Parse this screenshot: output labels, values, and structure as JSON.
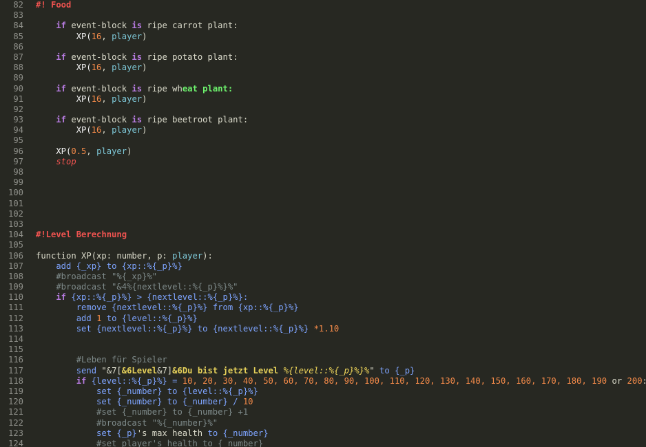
{
  "editor": {
    "lines": [
      {
        "n": "82",
        "tokens": [
          {
            "t": "#! Food",
            "c": "header"
          }
        ]
      },
      {
        "n": "83",
        "tokens": []
      },
      {
        "n": "84",
        "tokens": [
          {
            "t": "    if",
            "c": "kw"
          },
          {
            "t": " event-block ",
            "c": "plain"
          },
          {
            "t": "is",
            "c": "kw"
          },
          {
            "t": " ripe carrot plant:",
            "c": "plain"
          }
        ]
      },
      {
        "n": "85",
        "tokens": [
          {
            "t": "        XP(",
            "c": "fn"
          },
          {
            "t": "16",
            "c": "num"
          },
          {
            "t": ", ",
            "c": "plain"
          },
          {
            "t": "player",
            "c": "type"
          },
          {
            "t": ")",
            "c": "plain"
          }
        ]
      },
      {
        "n": "86",
        "tokens": []
      },
      {
        "n": "87",
        "tokens": [
          {
            "t": "    if",
            "c": "kw"
          },
          {
            "t": " event-block ",
            "c": "plain"
          },
          {
            "t": "is",
            "c": "kw"
          },
          {
            "t": " ripe potato plant:",
            "c": "plain"
          }
        ]
      },
      {
        "n": "88",
        "tokens": [
          {
            "t": "        XP(",
            "c": "fn"
          },
          {
            "t": "16",
            "c": "num"
          },
          {
            "t": ", ",
            "c": "plain"
          },
          {
            "t": "player",
            "c": "type"
          },
          {
            "t": ")",
            "c": "plain"
          }
        ]
      },
      {
        "n": "89",
        "tokens": []
      },
      {
        "n": "90",
        "tokens": [
          {
            "t": "    if",
            "c": "kw"
          },
          {
            "t": " event-block ",
            "c": "plain"
          },
          {
            "t": "is",
            "c": "kw"
          },
          {
            "t": " ripe wh",
            "c": "plain"
          },
          {
            "t": "eat plant:",
            "c": "hl"
          }
        ]
      },
      {
        "n": "91",
        "tokens": [
          {
            "t": "        XP(",
            "c": "fn"
          },
          {
            "t": "16",
            "c": "num"
          },
          {
            "t": ", ",
            "c": "plain"
          },
          {
            "t": "player",
            "c": "type"
          },
          {
            "t": ")",
            "c": "plain"
          }
        ]
      },
      {
        "n": "92",
        "tokens": []
      },
      {
        "n": "93",
        "tokens": [
          {
            "t": "    if",
            "c": "kw"
          },
          {
            "t": " event-block ",
            "c": "plain"
          },
          {
            "t": "is",
            "c": "kw"
          },
          {
            "t": " ripe beetroot plant:",
            "c": "plain"
          }
        ]
      },
      {
        "n": "94",
        "tokens": [
          {
            "t": "        XP(",
            "c": "fn"
          },
          {
            "t": "16",
            "c": "num"
          },
          {
            "t": ", ",
            "c": "plain"
          },
          {
            "t": "player",
            "c": "type"
          },
          {
            "t": ")",
            "c": "plain"
          }
        ]
      },
      {
        "n": "95",
        "tokens": []
      },
      {
        "n": "96",
        "tokens": [
          {
            "t": "    XP(",
            "c": "fn"
          },
          {
            "t": "0.5",
            "c": "num"
          },
          {
            "t": ", ",
            "c": "plain"
          },
          {
            "t": "player",
            "c": "type"
          },
          {
            "t": ")",
            "c": "plain"
          }
        ]
      },
      {
        "n": "97",
        "tokens": [
          {
            "t": "    stop",
            "c": "stop"
          }
        ]
      },
      {
        "n": "98",
        "tokens": []
      },
      {
        "n": "99",
        "tokens": []
      },
      {
        "n": "100",
        "tokens": []
      },
      {
        "n": "101",
        "tokens": []
      },
      {
        "n": "102",
        "tokens": []
      },
      {
        "n": "103",
        "tokens": []
      },
      {
        "n": "104",
        "tokens": [
          {
            "t": "#!Level Berechnung",
            "c": "header"
          }
        ]
      },
      {
        "n": "105",
        "tokens": []
      },
      {
        "n": "106",
        "tokens": [
          {
            "t": "function XP(xp: number, p: ",
            "c": "plain"
          },
          {
            "t": "player",
            "c": "type"
          },
          {
            "t": "):",
            "c": "plain"
          }
        ]
      },
      {
        "n": "107",
        "tokens": [
          {
            "t": "    add ",
            "c": "var"
          },
          {
            "t": "{_xp}",
            "c": "var"
          },
          {
            "t": " to ",
            "c": "var"
          },
          {
            "t": "{xp::%{_p}%}",
            "c": "var"
          }
        ]
      },
      {
        "n": "108",
        "tokens": [
          {
            "t": "    #broadcast \"%{_xp}%\"",
            "c": "comment"
          }
        ]
      },
      {
        "n": "109",
        "tokens": [
          {
            "t": "    #broadcast \"&4%{nextlevel::%{_p}%}%\"",
            "c": "comment"
          }
        ]
      },
      {
        "n": "110",
        "tokens": [
          {
            "t": "    if",
            "c": "kw"
          },
          {
            "t": " {xp::%{_p}%} > {nextlevel::%{_p}%}:",
            "c": "var"
          }
        ]
      },
      {
        "n": "111",
        "tokens": [
          {
            "t": "        remove {nextlevel::%{_p}%} from {xp::%{_p}%}",
            "c": "var"
          }
        ]
      },
      {
        "n": "112",
        "tokens": [
          {
            "t": "        add ",
            "c": "var"
          },
          {
            "t": "1",
            "c": "num"
          },
          {
            "t": " to {level::%{_p}%}",
            "c": "var"
          }
        ]
      },
      {
        "n": "113",
        "tokens": [
          {
            "t": "        set {nextlevel::%{_p}%} to {nextlevel::%{_p}%} ",
            "c": "var"
          },
          {
            "t": "*1.10",
            "c": "num"
          }
        ]
      },
      {
        "n": "114",
        "tokens": []
      },
      {
        "n": "115",
        "tokens": []
      },
      {
        "n": "116",
        "tokens": [
          {
            "t": "        #Leben für Spieler",
            "c": "comment"
          }
        ]
      },
      {
        "n": "117",
        "tokens": [
          {
            "t": "        send ",
            "c": "var"
          },
          {
            "t": "\"&7[",
            "c": "str"
          },
          {
            "t": "&6Level",
            "c": "fmt"
          },
          {
            "t": "&7]",
            "c": "str"
          },
          {
            "t": "&6Du bist jetzt Level ",
            "c": "fmt"
          },
          {
            "t": "%{level::%{_p}%}%",
            "c": "fmt2"
          },
          {
            "t": "\"",
            "c": "str"
          },
          {
            "t": " to {_p}",
            "c": "var"
          }
        ]
      },
      {
        "n": "118",
        "tokens": [
          {
            "t": "        if",
            "c": "kw"
          },
          {
            "t": " {level::%{_p}%} = ",
            "c": "var"
          },
          {
            "t": "10, 20, 30, 40, 50, 60, 70, 80, 90, 100, 110, 120, 130, 140, 150, 160, 170, 180, 190",
            "c": "num"
          },
          {
            "t": " or ",
            "c": "plain"
          },
          {
            "t": "200",
            "c": "num"
          },
          {
            "t": ":",
            "c": "plain"
          }
        ]
      },
      {
        "n": "119",
        "tokens": [
          {
            "t": "            set {_number} to {level::%{_p}%}",
            "c": "var"
          }
        ]
      },
      {
        "n": "120",
        "tokens": [
          {
            "t": "            set {_number} to {_number} / ",
            "c": "var"
          },
          {
            "t": "10",
            "c": "num"
          }
        ]
      },
      {
        "n": "121",
        "tokens": [
          {
            "t": "            #set {_number} to {_number} +1",
            "c": "comment"
          }
        ]
      },
      {
        "n": "122",
        "tokens": [
          {
            "t": "            #broadcast \"%{_number}%\"",
            "c": "comment"
          }
        ]
      },
      {
        "n": "123",
        "tokens": [
          {
            "t": "            set {_p}",
            "c": "var"
          },
          {
            "t": "'s max health ",
            "c": "plain"
          },
          {
            "t": "to {_number}",
            "c": "var"
          }
        ]
      },
      {
        "n": "124",
        "tokens": [
          {
            "t": "            #set player's health to {_number}",
            "c": "comment"
          }
        ]
      }
    ]
  }
}
